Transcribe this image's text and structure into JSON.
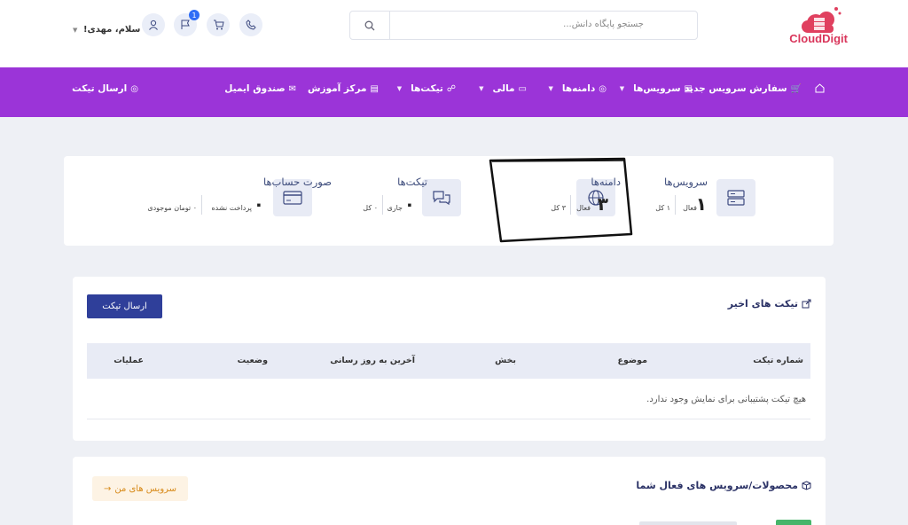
{
  "brand": {
    "name": "CloudDigit"
  },
  "search": {
    "placeholder": "جستجو پایگاه دانش..."
  },
  "header": {
    "greeting": "سلام، مهدی!",
    "notification_count": "1"
  },
  "nav": {
    "items": [
      {
        "label": "سفارش سرویس جدید",
        "icon": "cart-icon"
      },
      {
        "label": "سرویس‌ها",
        "icon": "server-icon",
        "dropdown": true
      },
      {
        "label": "دامنه‌ها",
        "icon": "globe-icon",
        "dropdown": true
      },
      {
        "label": "مالی",
        "icon": "wallet-icon",
        "dropdown": true
      },
      {
        "label": "تیکت‌ها",
        "icon": "support-icon",
        "dropdown": true
      },
      {
        "label": "مرکز آموزش",
        "icon": "book-icon"
      },
      {
        "label": "صندوق ایمیل",
        "icon": "mail-icon"
      }
    ],
    "send_ticket": "ارسال تیکت"
  },
  "stats": {
    "services": {
      "title": "سرویس‌ها",
      "count": "۱",
      "status": "فعال",
      "total": "۱ کل"
    },
    "domains": {
      "title": "دامنه‌ها",
      "count": "۳",
      "status": "فعال",
      "total": "۳ کل"
    },
    "tickets": {
      "title": "تیکت‌ها",
      "count": "۰",
      "status": "جاری",
      "total": "۰ کل"
    },
    "invoices": {
      "title": "صورت حساب‌ها",
      "count": "۰",
      "status": "پرداخت نشده",
      "total": "۰ تومان موجودی"
    }
  },
  "tickets_card": {
    "title": "تیکت های اخیر",
    "send_button": "ارسال تیکت",
    "columns": [
      "شماره تیکت",
      "موضوع",
      "بخش",
      "آخرین به روز رسانی",
      "وضعیت",
      "عملیات"
    ],
    "empty_text": "هیچ تیکت پشتیبانی برای نمایش وجود ندارد."
  },
  "services_card": {
    "title": "محصولات/سرویس های فعال شما",
    "button": "سرویس های من"
  }
}
